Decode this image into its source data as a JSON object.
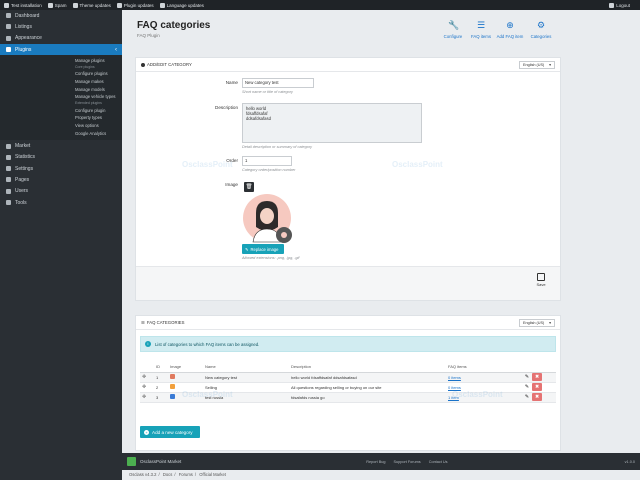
{
  "topbar": {
    "items": [
      {
        "label": "Test installation",
        "icon": "home-icon"
      },
      {
        "label": "Spam",
        "icon": "spam-icon"
      },
      {
        "label": "Theme updates",
        "icon": "theme-icon"
      },
      {
        "label": "Plugin updates",
        "icon": "plugin-icon"
      },
      {
        "label": "Language updates",
        "icon": "language-icon"
      }
    ],
    "logout": "Logout"
  },
  "sidebar": {
    "items": [
      {
        "label": "Dashboard",
        "icon": "dashboard-icon"
      },
      {
        "label": "Listings",
        "icon": "listings-icon"
      },
      {
        "label": "Appearance",
        "icon": "appearance-icon"
      },
      {
        "label": "Plugins",
        "icon": "plugins-icon",
        "active": true
      }
    ],
    "submenu": {
      "group1": [
        "Manage plugins"
      ],
      "heading1": "Core plugins",
      "group2": [
        "Configure plugins",
        "Manage makes",
        "Manage models",
        "Manage vehicle types"
      ],
      "heading2": "Extended plugins",
      "group3": [
        "Configure plugin",
        "Property types",
        "View options",
        "Google Analytics"
      ]
    },
    "items_after": [
      {
        "label": "Market",
        "icon": "market-icon"
      },
      {
        "label": "Statistics",
        "icon": "statistics-icon"
      },
      {
        "label": "Settings",
        "icon": "settings-icon"
      },
      {
        "label": "Pages",
        "icon": "pages-icon"
      },
      {
        "label": "Users",
        "icon": "users-icon"
      },
      {
        "label": "Tools",
        "icon": "tools-icon"
      }
    ]
  },
  "header": {
    "title": "FAQ categories",
    "subtitle": "FAQ Plugin",
    "tools": [
      {
        "label": "Configure",
        "glyph": "🔧"
      },
      {
        "label": "FAQ items",
        "glyph": "☰"
      },
      {
        "label": "Add FAQ item",
        "glyph": "⊕"
      },
      {
        "label": "Categories",
        "glyph": "⚙"
      }
    ]
  },
  "edit_card": {
    "heading": "ADD/EDIT CATEGORY",
    "language": "English (US)",
    "name_label": "Name",
    "name_value": "New category test",
    "name_help": "Short name or title of category",
    "description_label": "Description",
    "description_lines": [
      "hello world",
      "fdsaffdsafaf",
      "ddsafdsafasd"
    ],
    "description_help": "Detail description or summary of category",
    "order_label": "Order",
    "order_value": "1",
    "order_help": "Category order/position number",
    "image_label": "Image",
    "replace_label": "Replace image",
    "image_help": "Allowed extensions: .png, .jpg, .gif",
    "save_label": "Save"
  },
  "list_card": {
    "heading": "FAQ CATEGORIES",
    "language": "English (US)",
    "info": "List of categories to which FAQ items can be assigned.",
    "columns": [
      "ID",
      "Image",
      "Name",
      "Description",
      "FAQ items"
    ],
    "rows": [
      {
        "id": "1",
        "name": "New category test",
        "description": "hello world fdsaffdsafaf ddsafdsafasd",
        "items": "0 items",
        "img_color": "#e07a5f"
      },
      {
        "id": "2",
        "name": "Selling",
        "description": "All questions regarding selling or buying on our site",
        "items": "0 items",
        "img_color": "#f2a03d"
      },
      {
        "id": "3",
        "name": "test russia",
        "description": "fdsafafds russia go",
        "items": "1 item",
        "img_color": "#3a7bd5"
      }
    ],
    "add_label": "Add a new category"
  },
  "footer": {
    "brand": "OsclassPoint Market",
    "links": [
      "Report Bug",
      "Support Forums",
      "Contact Us"
    ],
    "version": "v1.0.0"
  },
  "bottom_links": [
    "Osclass v4.3.2",
    "Docs",
    "Forums",
    "Official Market"
  ],
  "watermark": "OsclassPoint"
}
